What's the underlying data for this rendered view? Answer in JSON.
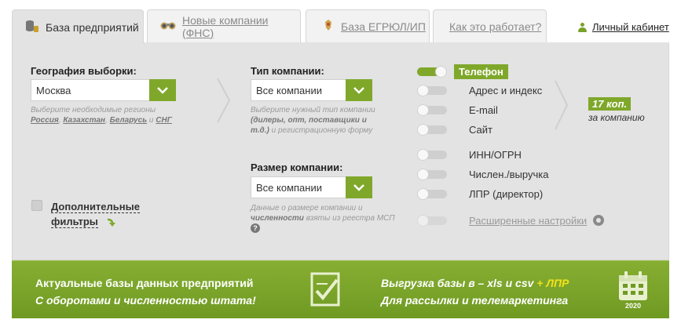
{
  "tabs": [
    {
      "label": "База предприятий",
      "active": true,
      "icon": "database-coins-icon"
    },
    {
      "label": "Новые компании (ФНС)",
      "active": false,
      "icon": "binoculars-icon"
    },
    {
      "label": "База ЕГРЮЛ/ИП",
      "active": false,
      "icon": "emblem-icon"
    },
    {
      "label": "Как это работает?",
      "active": false
    }
  ],
  "cabinet": {
    "label": "Личный кабинет",
    "icon": "person-icon"
  },
  "geography": {
    "title": "География выборки:",
    "value": "Москва",
    "hint_text": "Выберите необходимые регионы",
    "hint_links": [
      "Россия",
      "Казахстан",
      "Беларусь",
      "СНГ"
    ],
    "hint_and": "и"
  },
  "company_type": {
    "title": "Тип компании:",
    "value": "Все компании",
    "hint_pre": "Выберите нужный тип компании",
    "hint_bold": "(дилеры, опт, поставщики и т.д.)",
    "hint_post": "и регистрационную форму"
  },
  "company_size": {
    "title": "Размер компании:",
    "value": "Все компании",
    "hint_pre": "Данные о размере компании и",
    "hint_bold": "численности",
    "hint_post": "взяты из реестра МСП",
    "help": "?"
  },
  "extra_filters": {
    "line1": "Дополнительные",
    "line2": "фильтры"
  },
  "toggles": [
    {
      "label": "Телефон",
      "on": true
    },
    {
      "label": "Адрес и индекс",
      "on": false
    },
    {
      "label": "E-mail",
      "on": false
    },
    {
      "label": "Сайт",
      "on": false
    },
    {
      "label": "ИНН/ОГРН",
      "on": false
    },
    {
      "label": "Числен./выручка",
      "on": false
    },
    {
      "label": "ЛПР (директор)",
      "on": false
    },
    {
      "label": "Расширенные настройки",
      "on": false,
      "disabled": true
    }
  ],
  "price": {
    "badge": "17 коп.",
    "sub": "за компанию"
  },
  "banner": {
    "left_line1": "Актуальные базы данных предприятий",
    "left_line2": "С оборотами и численностью штата!",
    "right_prefix": "Выгрузка базы в – ",
    "right_formats": "xls и csv",
    "right_plus": " + ЛПР",
    "right_line2": "Для рассылки и телемаркетинга",
    "calendar_year": "2020"
  },
  "colors": {
    "accent": "#7fa82b",
    "panel": "#e3e3e3",
    "highlight": "#f2e21a"
  }
}
